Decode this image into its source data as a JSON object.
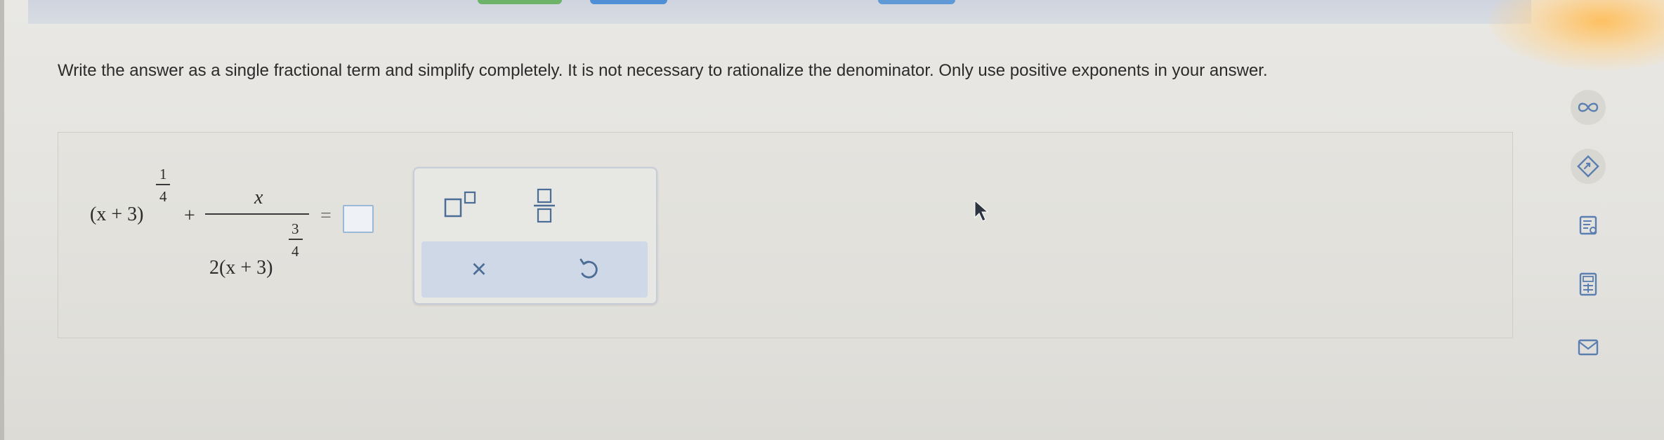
{
  "instructions": "Write the answer as a single fractional term and simplify completely. It is not necessary to rationalize the denominator. Only use positive exponents in your answer.",
  "expression": {
    "term1_base": "(x + 3)",
    "term1_exp_num": "1",
    "term1_exp_den": "4",
    "plus": "+",
    "frac_numerator": "x",
    "frac_denominator_base": "2(x + 3)",
    "frac_denominator_exp_num": "3",
    "frac_denominator_exp_den": "4",
    "equals": "="
  },
  "answer_input": {
    "value": ""
  },
  "palette": {
    "buttons": [
      "superscript-icon",
      "fraction-icon"
    ],
    "clear_label": "×",
    "undo_icon": "undo-icon"
  },
  "right_toolbar": {
    "icons": [
      "infinity-icon",
      "share-icon",
      "reader-icon",
      "calculator-icon",
      "mail-icon"
    ]
  },
  "colors": {
    "accent_blue": "#4c6d96",
    "palette_bar": "#cfd8e6",
    "input_border": "#9ab8d8"
  }
}
